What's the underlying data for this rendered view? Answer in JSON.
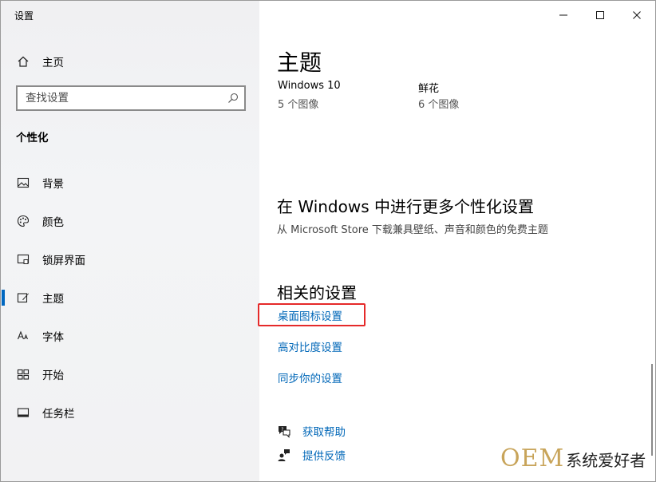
{
  "window": {
    "title": "设置"
  },
  "sidebar": {
    "home_label": "主页",
    "search_placeholder": "查找设置",
    "section_title": "个性化",
    "items": [
      {
        "label": "背景",
        "icon": "image-icon"
      },
      {
        "label": "颜色",
        "icon": "palette-icon"
      },
      {
        "label": "锁屏界面",
        "icon": "lock-screen-icon"
      },
      {
        "label": "主题",
        "icon": "theme-icon",
        "active": true
      },
      {
        "label": "字体",
        "icon": "font-icon"
      },
      {
        "label": "开始",
        "icon": "start-icon"
      },
      {
        "label": "任务栏",
        "icon": "taskbar-icon"
      }
    ]
  },
  "main": {
    "title": "主题",
    "themes": [
      {
        "name": "Windows 10",
        "count": "5 个图像"
      },
      {
        "name": "鲜花",
        "count": "6 个图像"
      }
    ],
    "more": {
      "heading": "在 Windows 中进行更多个性化设置",
      "desc": "从 Microsoft Store 下载兼具壁纸、声音和颜色的免费主题"
    },
    "related": {
      "heading": "相关的设置",
      "links": [
        "桌面图标设置",
        "高对比度设置",
        "同步你的设置"
      ]
    },
    "help": [
      {
        "label": "获取帮助",
        "icon": "help-chat-icon"
      },
      {
        "label": "提供反馈",
        "icon": "feedback-icon"
      }
    ]
  },
  "watermark": {
    "latin": "OEM",
    "cn": "系统爱好者"
  },
  "colors": {
    "accent": "#0067b8",
    "highlight": "#e52a2a",
    "watermark_gold": "#c8a45a"
  }
}
